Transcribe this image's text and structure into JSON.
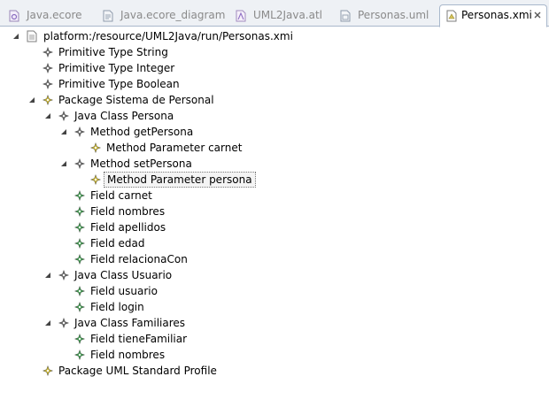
{
  "tabs": [
    {
      "label": "Java.ecore",
      "icon": "ecore-file-icon",
      "active": false
    },
    {
      "label": "Java.ecore_diagram",
      "icon": "diagram-file-icon",
      "active": false
    },
    {
      "label": "UML2Java.atl",
      "icon": "atl-file-icon",
      "active": false
    },
    {
      "label": "Personas.uml",
      "icon": "uml-file-icon",
      "active": false
    },
    {
      "label": "Personas.xmi",
      "icon": "xmi-file-icon",
      "active": true
    }
  ],
  "tree": {
    "root": "platform:/resource/UML2Java/run/Personas.xmi",
    "nodes": [
      {
        "label": "Primitive Type String",
        "level": 1,
        "expanded": null,
        "icon": "gray-diamond-icon"
      },
      {
        "label": "Primitive Type Integer",
        "level": 1,
        "expanded": null,
        "icon": "gray-diamond-icon"
      },
      {
        "label": "Primitive Type Boolean",
        "level": 1,
        "expanded": null,
        "icon": "gray-diamond-icon"
      },
      {
        "label": "Package Sistema de Personal",
        "level": 1,
        "expanded": true,
        "icon": "yellow-diamond-icon"
      },
      {
        "label": "Java Class Persona",
        "level": 2,
        "expanded": true,
        "icon": "gray-diamond-icon"
      },
      {
        "label": "Method getPersona",
        "level": 3,
        "expanded": true,
        "icon": "gray-diamond-icon"
      },
      {
        "label": "Method Parameter carnet",
        "level": 4,
        "expanded": null,
        "icon": "yellow-diamond-icon"
      },
      {
        "label": "Method setPersona",
        "level": 3,
        "expanded": true,
        "icon": "gray-diamond-icon"
      },
      {
        "label": "Method Parameter persona",
        "level": 4,
        "expanded": null,
        "icon": "yellow-diamond-icon",
        "selected": true
      },
      {
        "label": "Field carnet",
        "level": 3,
        "expanded": null,
        "icon": "green-diamond-icon"
      },
      {
        "label": "Field nombres",
        "level": 3,
        "expanded": null,
        "icon": "green-diamond-icon"
      },
      {
        "label": "Field apellidos",
        "level": 3,
        "expanded": null,
        "icon": "green-diamond-icon"
      },
      {
        "label": "Field edad",
        "level": 3,
        "expanded": null,
        "icon": "green-diamond-icon"
      },
      {
        "label": "Field relacionaCon",
        "level": 3,
        "expanded": null,
        "icon": "green-diamond-icon"
      },
      {
        "label": "Java Class Usuario",
        "level": 2,
        "expanded": true,
        "icon": "gray-diamond-icon"
      },
      {
        "label": "Field usuario",
        "level": 3,
        "expanded": null,
        "icon": "green-diamond-icon"
      },
      {
        "label": "Field login",
        "level": 3,
        "expanded": null,
        "icon": "green-diamond-icon"
      },
      {
        "label": "Java Class Familiares",
        "level": 2,
        "expanded": true,
        "icon": "gray-diamond-icon"
      },
      {
        "label": "Field tieneFamiliar",
        "level": 3,
        "expanded": null,
        "icon": "green-diamond-icon"
      },
      {
        "label": "Field nombres",
        "level": 3,
        "expanded": null,
        "icon": "green-diamond-icon"
      },
      {
        "label": "Package UML Standard Profile",
        "level": 1,
        "expanded": null,
        "icon": "yellow-diamond-icon"
      }
    ]
  },
  "colors": {
    "gray_icon": "#6b6b6b",
    "yellow_icon": "#c8b432",
    "green_icon": "#3f9b4f",
    "tab_border": "#a9b8cc"
  }
}
